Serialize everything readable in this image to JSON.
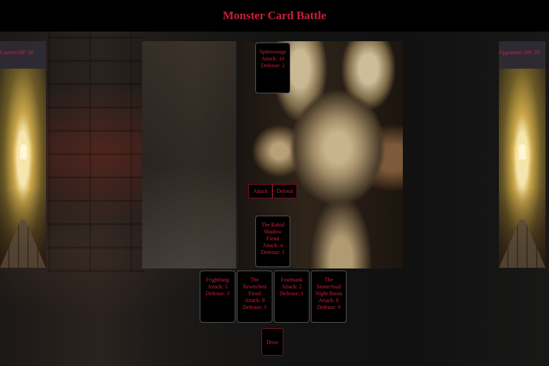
{
  "header": {
    "title": "Monster Card Battle"
  },
  "player": {
    "hp_label": "Current HP: 20"
  },
  "opponent": {
    "hp_label": "Opponents HP: 20"
  },
  "opponent_card": {
    "name": "Spiteswings",
    "attack": "Attack: 10",
    "defense": "Defense: 2"
  },
  "actions": {
    "attack_label": "Attack",
    "defend_label": "Defend"
  },
  "active_card": {
    "name": "The Rabid Shadow Fiend",
    "attack": "Attack: 4",
    "defense": "Defense: 1"
  },
  "hand": [
    {
      "name": "Frightfang",
      "attack": "Attack: 5",
      "defense": "Defense: 3"
    },
    {
      "name": "The Bewitched Fiend",
      "attack": "Attack: 9",
      "defense": "Defense: 3"
    },
    {
      "name": "Foulmask",
      "attack": "Attack: 2",
      "defense": "Defense: 1"
    },
    {
      "name": "The Stonecloud Night Bison",
      "attack": "Attack: 8",
      "defense": "Defense: 9"
    }
  ],
  "draw": {
    "label": "Draw"
  },
  "colors": {
    "accent": "#d21f3c",
    "card_bg": "#000000",
    "panel_bg": "#2d2a33"
  }
}
